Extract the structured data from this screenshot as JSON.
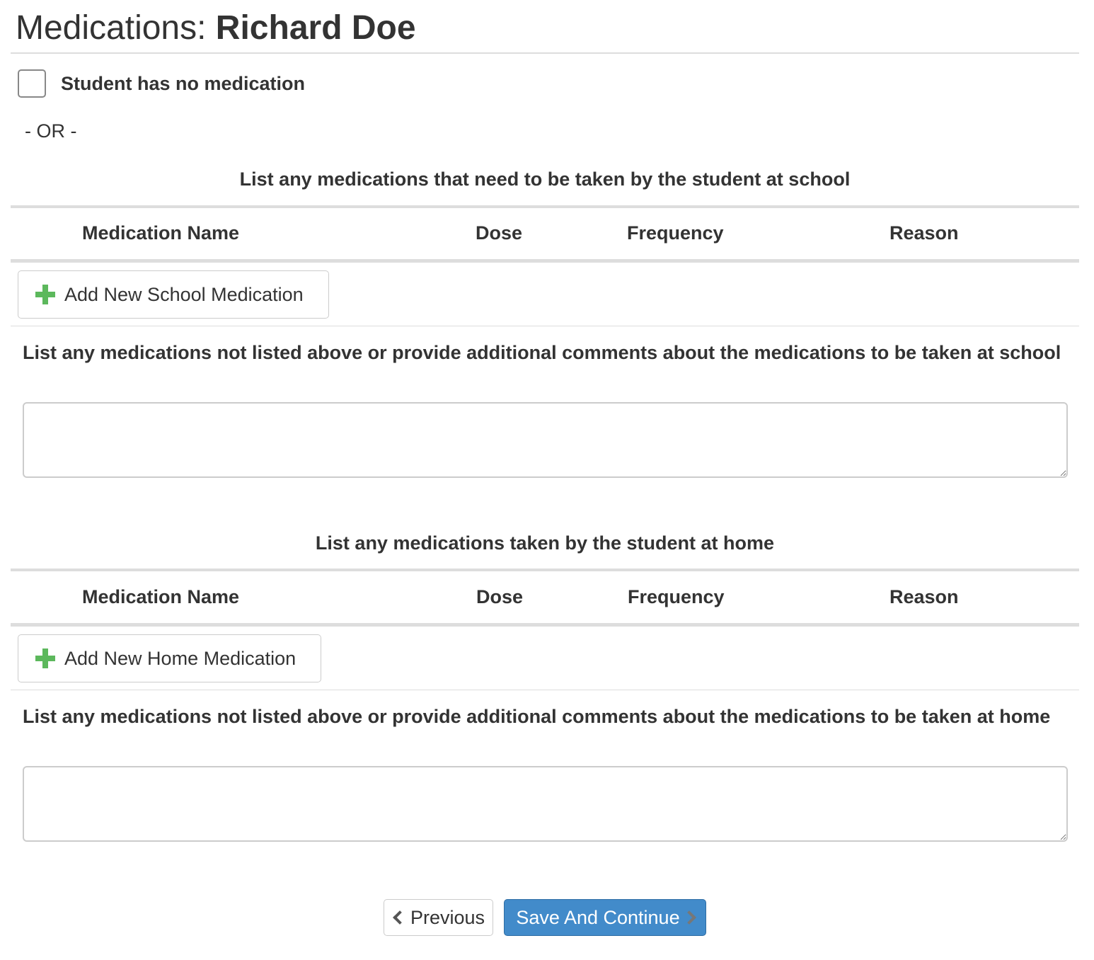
{
  "header": {
    "title_prefix": "Medications: ",
    "student_name": "Richard Doe"
  },
  "no_medication": {
    "label": "Student has no medication",
    "checked": false
  },
  "or_text": "- OR -",
  "school": {
    "heading": "List any medications that need to be taken by the student at school",
    "columns": [
      "Medication Name",
      "Dose",
      "Frequency",
      "Reason"
    ],
    "add_button": "Add New School Medication",
    "comment_label": "List any medications not listed above or provide additional comments about the medications to be taken at school",
    "comment_value": ""
  },
  "home": {
    "heading": "List any medications taken by the student at home",
    "columns": [
      "Medication Name",
      "Dose",
      "Frequency",
      "Reason"
    ],
    "add_button": "Add New Home Medication",
    "comment_label": "List any medications not listed above or provide additional comments about the medications to be taken at home",
    "comment_value": ""
  },
  "footer": {
    "previous_label": "Previous",
    "save_label": "Save And Continue"
  },
  "colors": {
    "accent": "#428bca",
    "plus": "#5cb85c",
    "text": "#333333"
  }
}
